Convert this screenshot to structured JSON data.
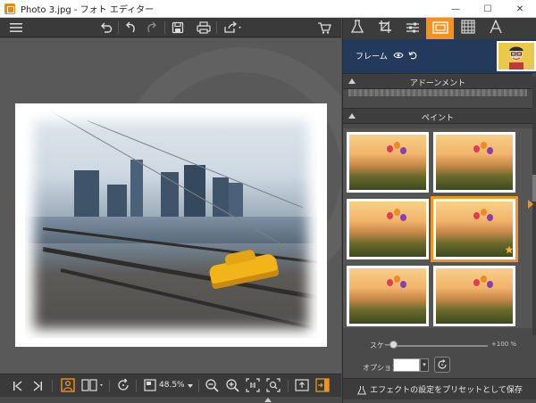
{
  "window": {
    "title": "Photo 3.jpg - フォト エディター"
  },
  "window_controls": {
    "minimize": "—",
    "maximize": "☐",
    "close": "✕"
  },
  "toolbar": {
    "icons": [
      "menu-icon",
      "undo-all-icon",
      "undo-icon",
      "redo-icon",
      "save-icon",
      "print-icon",
      "share-icon",
      "cart-icon"
    ]
  },
  "panel": {
    "tabs": [
      {
        "name": "effects",
        "icon": "flask-icon",
        "active": false
      },
      {
        "name": "crop",
        "icon": "crop-icon",
        "active": false
      },
      {
        "name": "adjust",
        "icon": "sliders-icon",
        "active": false
      },
      {
        "name": "frame",
        "icon": "frame-icon",
        "active": true
      },
      {
        "name": "texture",
        "icon": "grid-pattern-icon",
        "active": false
      },
      {
        "name": "text",
        "icon": "text-icon",
        "active": false
      }
    ],
    "frame_title": "フレーム",
    "sections": {
      "ornament": "アドーンメント",
      "paint": "ペイント"
    },
    "scale_label": "スケール",
    "scale_value": "+100 %",
    "scale_level": 0,
    "option_label": "オプション",
    "option_color": "#ffffff",
    "save_preset": "エフェクトの設定をプリセットとして保存"
  },
  "bottombar": {
    "zoom": "48.5%"
  },
  "colors": {
    "accent": "#f5921e",
    "panel_header": "#233a5c"
  }
}
